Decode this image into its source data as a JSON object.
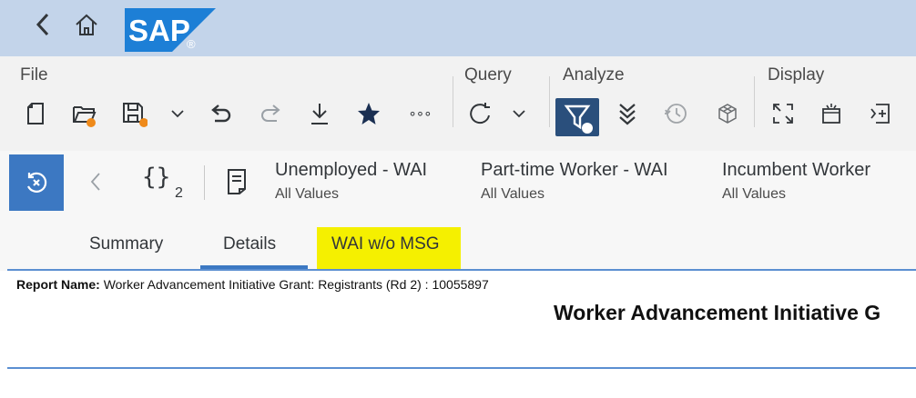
{
  "shell": {
    "logo_text": "SAP",
    "logo_reg": "®",
    "colors": {
      "bar": "#c3d4ea",
      "logo": "#1d7fd6"
    }
  },
  "toolbar": {
    "groups": {
      "file": "File",
      "query": "Query",
      "analyze": "Analyze",
      "display": "Display"
    },
    "icons": [
      "new-document-icon",
      "open-folder-icon",
      "save-icon",
      "chevron-down-icon",
      "undo-icon",
      "redo-icon",
      "download-icon",
      "favorite-star-icon",
      "more-icon",
      "refresh-icon",
      "chevron-down-icon",
      "filter-icon",
      "drill-down-icon",
      "history-icon",
      "cube-icon",
      "fullscreen-icon",
      "new-window-icon",
      "add-panel-icon"
    ],
    "more_glyph": "∘∘∘"
  },
  "filterbar": {
    "braces": "{}",
    "count": "2",
    "chips": [
      {
        "title": "Unemployed - WAI",
        "value": "All Values"
      },
      {
        "title": "Part-time Worker - WAI",
        "value": "All Values"
      },
      {
        "title": "Incumbent Worker",
        "value": "All Values"
      }
    ]
  },
  "tabs": [
    {
      "label": "Summary"
    },
    {
      "label": "Details"
    },
    {
      "label": "WAI w/o MSG"
    }
  ],
  "report": {
    "name_label": "Report Name:",
    "name_value": "Worker Advancement Initiative Grant: Registrants (Rd 2) : 10055897",
    "title": "Worker Advancement Initiative G"
  },
  "colors": {
    "accent": "#3c78c2",
    "active_filter": "#2a4f7c",
    "highlight": "#f5f000",
    "orange_dot": "#ef8a1a"
  }
}
